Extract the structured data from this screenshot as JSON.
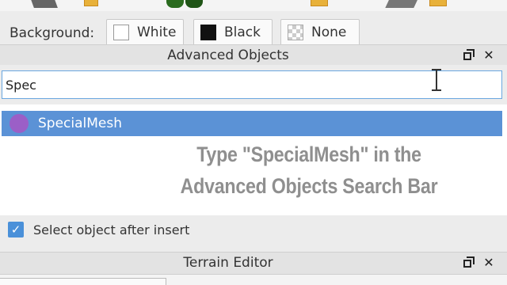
{
  "background": {
    "label": "Background:",
    "options": [
      {
        "label": "White",
        "swatch": "#ffffff"
      },
      {
        "label": "Black",
        "swatch": "#111111"
      },
      {
        "label": "None",
        "swatch": "checker"
      }
    ]
  },
  "advanced_objects": {
    "title": "Advanced Objects",
    "search_value": "Spec",
    "results": [
      {
        "label": "SpecialMesh",
        "icon": "special-mesh-icon",
        "selected": true
      }
    ],
    "select_after_insert_label": "Select object after insert",
    "select_after_insert_checked": true
  },
  "instruction": {
    "line1": "Type \"SpecialMesh\" in the",
    "line2": "Advanced Objects Search Bar"
  },
  "terrain_editor": {
    "title": "Terrain Editor"
  },
  "colors": {
    "selection": "#5b92d6",
    "search_border": "#6aa7e0",
    "mesh_icon": "#9b5fc7",
    "checkbox": "#4a90d9",
    "caption_text": "#8f8f8f"
  }
}
